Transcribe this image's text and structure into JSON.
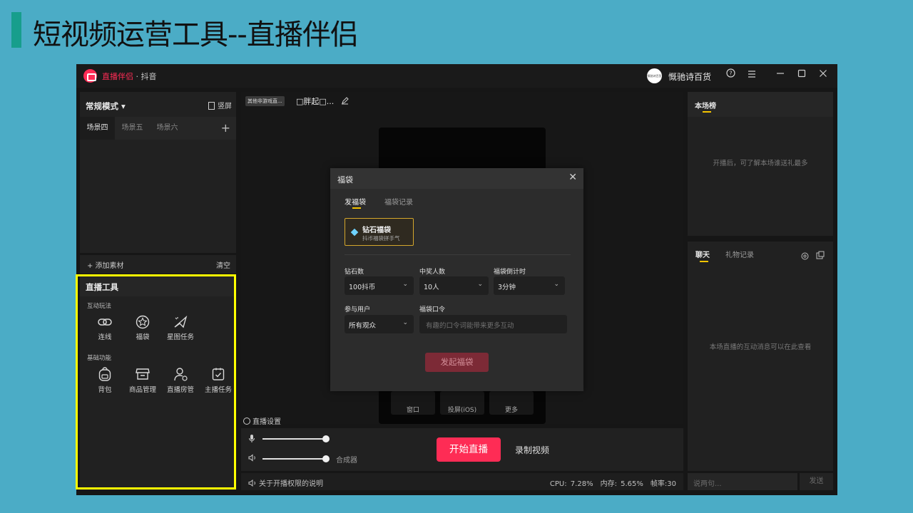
{
  "slide": {
    "title": "短视频运营工具--直播伴侣"
  },
  "titlebar": {
    "app_name": "直播伴侣",
    "app_suffix": " · 抖音",
    "user_avatar_text": "慨驰诗百货",
    "user_name": "慨驰诗百货",
    "icons": [
      "help-icon",
      "menu-icon",
      "minimize-icon",
      "maximize-icon",
      "close-icon"
    ]
  },
  "left_panel": {
    "mode_label": "常规模式 ▾",
    "vertical_label": "竖屏",
    "scene_tabs": [
      "场景四",
      "场景五",
      "场景六"
    ],
    "add_scene": "+",
    "add_material": "+ 添加素材",
    "clear": "清空"
  },
  "tools": {
    "title": "直播工具",
    "groups": [
      {
        "label": "互动玩法",
        "items": [
          {
            "label": "连线",
            "icon": "link-icon"
          },
          {
            "label": "福袋",
            "icon": "star-bag-icon"
          },
          {
            "label": "星图任务",
            "icon": "star-map-icon"
          }
        ]
      },
      {
        "label": "基础功能",
        "items": [
          {
            "label": "背包",
            "icon": "backpack-icon"
          },
          {
            "label": "商品管理",
            "icon": "shop-icon"
          },
          {
            "label": "直播房管",
            "icon": "room-admin-icon"
          },
          {
            "label": "主播任务",
            "icon": "task-icon"
          }
        ]
      }
    ],
    "highlight_color": "#ffff00"
  },
  "center": {
    "room_tag": "其他非游戏直...",
    "room_title": "□胖起□...",
    "preview_buttons": [
      "窗口",
      "投屏(iOS)",
      "更多"
    ],
    "live_settings": "直播设置"
  },
  "controls": {
    "mic_level": 1.0,
    "speaker_level": 1.0,
    "mixer": "合成器",
    "start_live": "开始直播",
    "record_video": "录制视频"
  },
  "status": {
    "permission_note": "关于开播权限的说明",
    "cpu": "CPU: 7.28%",
    "memory": "内存: 5.65%",
    "fps": "帧率:30"
  },
  "rank": {
    "title": "本场榜",
    "empty_text": "开播后，可了解本场谁送礼最多"
  },
  "chat": {
    "tab_chat": "聊天",
    "tab_gift": "礼物记录",
    "empty_text": "本场直播的互动消息可以在此查看",
    "input_placeholder": "说两句...",
    "send": "发送"
  },
  "modal": {
    "title": "福袋",
    "close": "✕",
    "tab_send": "发福袋",
    "tab_record": "福袋记录",
    "bag_name": "钻石福袋",
    "bag_sub": "抖币福袋拼手气",
    "fields": {
      "diamonds_label": "钻石数",
      "diamonds_value": "100抖币",
      "winners_label": "中奖人数",
      "winners_value": "10人",
      "countdown_label": "福袋倒计时",
      "countdown_value": "3分钟",
      "participants_label": "参与用户",
      "participants_value": "所有观众",
      "password_label": "福袋口令",
      "password_placeholder": "有趣的口令词能带来更多互动"
    },
    "launch": "发起福袋"
  },
  "colors": {
    "accent_red": "#fe2c55",
    "tab_underline": "#f5c400",
    "bag_border": "#d4a72c",
    "slide_bg": "#4bacc6",
    "slide_bar": "#179e8c"
  }
}
